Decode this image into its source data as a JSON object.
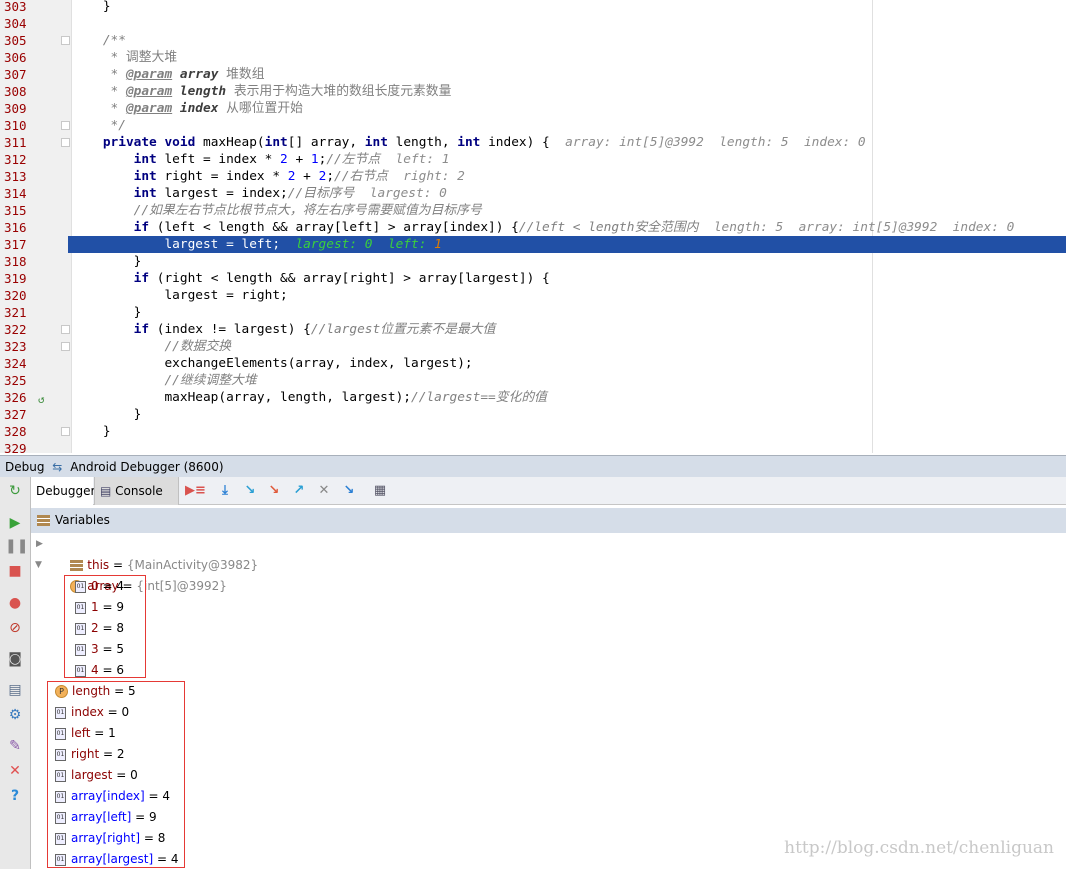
{
  "editor": {
    "lines": [
      {
        "num": "303",
        "tokens": [
          {
            "t": "    }",
            "c": ""
          }
        ]
      },
      {
        "num": "304",
        "tokens": []
      },
      {
        "num": "305",
        "fold": true,
        "tokens": [
          {
            "t": "    /**",
            "c": "cm"
          }
        ]
      },
      {
        "num": "306",
        "tokens": [
          {
            "t": "     * 调整大堆",
            "c": "cn"
          }
        ]
      },
      {
        "num": "307",
        "tokens": [
          {
            "t": "     * ",
            "c": "cn"
          },
          {
            "t": "@param",
            "c": "tag"
          },
          {
            "t": " ",
            "c": ""
          },
          {
            "t": "array",
            "c": "pn"
          },
          {
            "t": " 堆数组",
            "c": "cn"
          }
        ]
      },
      {
        "num": "308",
        "tokens": [
          {
            "t": "     * ",
            "c": "cn"
          },
          {
            "t": "@param",
            "c": "tag"
          },
          {
            "t": " ",
            "c": ""
          },
          {
            "t": "length",
            "c": "pn"
          },
          {
            "t": " 表示用于构造大堆的数组长度元素数量",
            "c": "cn"
          }
        ]
      },
      {
        "num": "309",
        "tokens": [
          {
            "t": "     * ",
            "c": "cn"
          },
          {
            "t": "@param",
            "c": "tag"
          },
          {
            "t": " ",
            "c": ""
          },
          {
            "t": "index",
            "c": "pn"
          },
          {
            "t": " 从哪位置开始",
            "c": "cn"
          }
        ]
      },
      {
        "num": "310",
        "fold": true,
        "tokens": [
          {
            "t": "     */",
            "c": "cm"
          }
        ]
      },
      {
        "num": "311",
        "fold": true,
        "tokens": [
          {
            "t": "    ",
            "c": ""
          },
          {
            "t": "private void",
            "c": "kw"
          },
          {
            "t": " maxHeap(",
            "c": ""
          },
          {
            "t": "int",
            "c": "kw"
          },
          {
            "t": "[] array, ",
            "c": ""
          },
          {
            "t": "int",
            "c": "kw"
          },
          {
            "t": " length, ",
            "c": ""
          },
          {
            "t": "int",
            "c": "kw"
          },
          {
            "t": " index) {  ",
            "c": ""
          },
          {
            "t": "array: int[5]@3992  length: 5  index: 0",
            "c": "hint"
          }
        ]
      },
      {
        "num": "312",
        "tokens": [
          {
            "t": "        ",
            "c": ""
          },
          {
            "t": "int",
            "c": "kw"
          },
          {
            "t": " left = index * ",
            "c": ""
          },
          {
            "t": "2",
            "c": "num"
          },
          {
            "t": " + ",
            "c": ""
          },
          {
            "t": "1",
            "c": "num"
          },
          {
            "t": ";",
            "c": ""
          },
          {
            "t": "//左节点",
            "c": "cm"
          },
          {
            "t": "  left: 1",
            "c": "hint"
          }
        ]
      },
      {
        "num": "313",
        "tokens": [
          {
            "t": "        ",
            "c": ""
          },
          {
            "t": "int",
            "c": "kw"
          },
          {
            "t": " right = index * ",
            "c": ""
          },
          {
            "t": "2",
            "c": "num"
          },
          {
            "t": " + ",
            "c": ""
          },
          {
            "t": "2",
            "c": "num"
          },
          {
            "t": ";",
            "c": ""
          },
          {
            "t": "//右节点",
            "c": "cm"
          },
          {
            "t": "  right: 2",
            "c": "hint"
          }
        ]
      },
      {
        "num": "314",
        "tokens": [
          {
            "t": "        ",
            "c": ""
          },
          {
            "t": "int",
            "c": "kw"
          },
          {
            "t": " largest = index;",
            "c": ""
          },
          {
            "t": "//目标序号",
            "c": "cm"
          },
          {
            "t": "  largest: 0",
            "c": "hint"
          }
        ]
      },
      {
        "num": "315",
        "tokens": [
          {
            "t": "        //如果左右节点比根节点大，将左右序号需要赋值为目标序号",
            "c": "cm"
          }
        ]
      },
      {
        "num": "316",
        "tokens": [
          {
            "t": "        ",
            "c": ""
          },
          {
            "t": "if",
            "c": "kw"
          },
          {
            "t": " (left < length && array[left] > array[index]) {",
            "c": ""
          },
          {
            "t": "//left < length安全范围内",
            "c": "cm"
          },
          {
            "t": "  length: 5  array: int[5]@3992  index: 0",
            "c": "hint"
          }
        ]
      },
      {
        "num": "317",
        "selected": true,
        "tokens": [
          {
            "t": "            largest = left;  ",
            "c": ""
          },
          {
            "t": "largest: 0  left: ",
            "c": "hintg"
          },
          {
            "t": "1",
            "c": "hinto"
          }
        ]
      },
      {
        "num": "318",
        "tokens": [
          {
            "t": "        }",
            "c": ""
          }
        ]
      },
      {
        "num": "319",
        "tokens": [
          {
            "t": "        ",
            "c": ""
          },
          {
            "t": "if",
            "c": "kw"
          },
          {
            "t": " (right < length && array[right] > array[largest]) {",
            "c": ""
          }
        ]
      },
      {
        "num": "320",
        "tokens": [
          {
            "t": "            largest = right;",
            "c": ""
          }
        ]
      },
      {
        "num": "321",
        "tokens": [
          {
            "t": "        }",
            "c": ""
          }
        ]
      },
      {
        "num": "322",
        "fold": true,
        "tokens": [
          {
            "t": "        ",
            "c": ""
          },
          {
            "t": "if",
            "c": "kw"
          },
          {
            "t": " (index != largest) {",
            "c": ""
          },
          {
            "t": "//largest位置元素不是最大值",
            "c": "cm"
          }
        ]
      },
      {
        "num": "323",
        "fold": true,
        "tokens": [
          {
            "t": "            //数据交换",
            "c": "cm"
          }
        ]
      },
      {
        "num": "324",
        "tokens": [
          {
            "t": "            exchangeElements(array, index, largest);",
            "c": ""
          }
        ]
      },
      {
        "num": "325",
        "tokens": [
          {
            "t": "            //继续调整大堆",
            "c": "cm"
          }
        ]
      },
      {
        "num": "326",
        "recursion": true,
        "tokens": [
          {
            "t": "            maxHeap(array, length, largest);",
            "c": ""
          },
          {
            "t": "//largest==变化的值",
            "c": "cm"
          }
        ]
      },
      {
        "num": "327",
        "tokens": [
          {
            "t": "        }",
            "c": ""
          }
        ]
      },
      {
        "num": "328",
        "fold": true,
        "tokens": [
          {
            "t": "    }",
            "c": ""
          }
        ]
      },
      {
        "num": "329",
        "tokens": []
      }
    ]
  },
  "debug": {
    "title": "Debug",
    "session": "Android Debugger (8600)",
    "tabs": {
      "debugger": "Debugger",
      "console": "Console"
    },
    "variables_label": "Variables"
  },
  "variables": {
    "this": {
      "name": "this",
      "eq": " = ",
      "value": "{MainActivity@3982}"
    },
    "array": {
      "name": "array",
      "eq": " = ",
      "value": "{int[5]@3992}"
    },
    "array_items": [
      {
        "name": "0",
        "value": "4"
      },
      {
        "name": "1",
        "value": "9"
      },
      {
        "name": "2",
        "value": "8"
      },
      {
        "name": "3",
        "value": "5"
      },
      {
        "name": "4",
        "value": "6"
      }
    ],
    "locals": [
      {
        "name": "length",
        "value": "5",
        "icon": "param",
        "watch": false
      },
      {
        "name": "index",
        "value": "0",
        "icon": "local",
        "watch": false
      },
      {
        "name": "left",
        "value": "1",
        "icon": "local",
        "watch": false
      },
      {
        "name": "right",
        "value": "2",
        "icon": "local",
        "watch": false
      },
      {
        "name": "largest",
        "value": "0",
        "icon": "local",
        "watch": false
      },
      {
        "name": "array[index]",
        "value": "4",
        "icon": "local",
        "watch": true
      },
      {
        "name": "array[left]",
        "value": "9",
        "icon": "local",
        "watch": true
      },
      {
        "name": "array[right]",
        "value": "8",
        "icon": "local",
        "watch": true
      },
      {
        "name": "array[largest]",
        "value": "4",
        "icon": "local",
        "watch": true
      }
    ]
  },
  "watermark": "http://blog.csdn.net/chenliguan",
  "colors": {
    "selection": "#2150a6",
    "highlight_box": "#e53935",
    "line_number": "#990000"
  }
}
